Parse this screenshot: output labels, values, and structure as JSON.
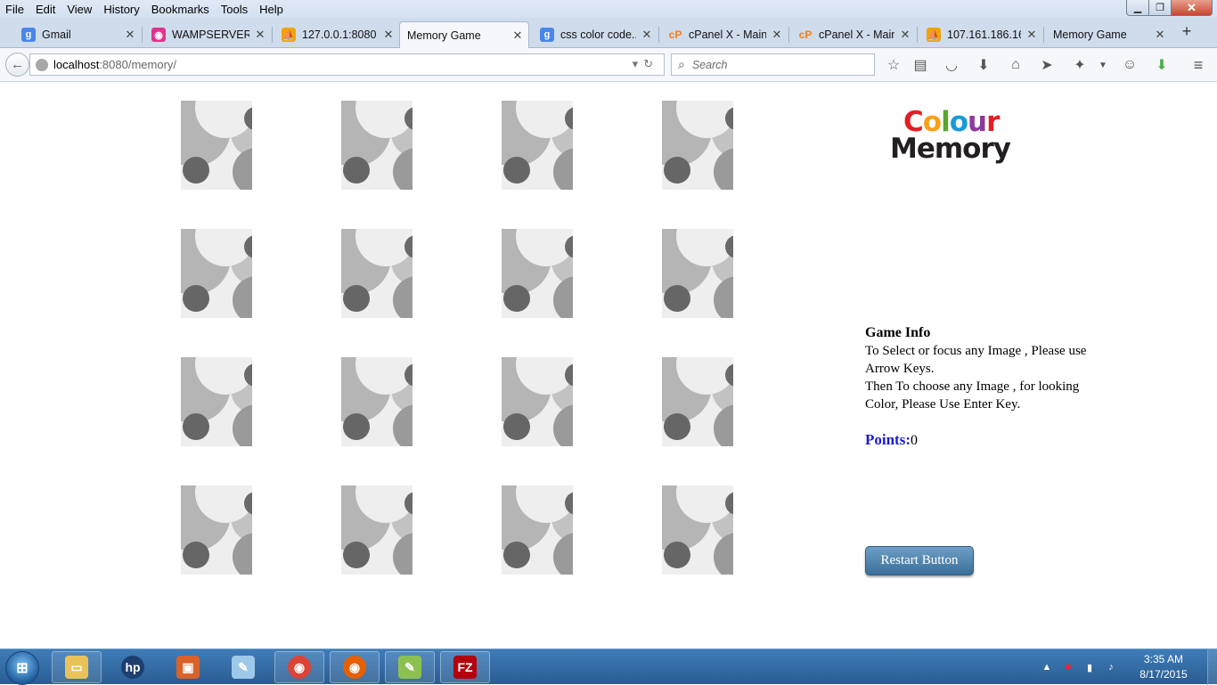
{
  "browser": {
    "menu": [
      "File",
      "Edit",
      "View",
      "History",
      "Bookmarks",
      "Tools",
      "Help"
    ],
    "tabs": [
      {
        "title": "Gmail",
        "icon": "google-icon",
        "icon_color": "#4a86e8",
        "active": false
      },
      {
        "title": "WAMPSERVER...",
        "icon": "wamp-icon",
        "icon_color": "#e0338d",
        "active": false
      },
      {
        "title": "127.0.0.1:8080 ...",
        "icon": "phpmyadmin-icon",
        "icon_color": "#f0a30a",
        "active": false
      },
      {
        "title": "Memory Game",
        "icon": "",
        "icon_color": "",
        "active": true
      },
      {
        "title": "css color code...",
        "icon": "google-icon",
        "icon_color": "#4a86e8",
        "active": false
      },
      {
        "title": "cPanel X - Main",
        "icon": "cpanel-icon",
        "icon_color": "#f57f17",
        "active": false
      },
      {
        "title": "cPanel X - Main",
        "icon": "cpanel-icon",
        "icon_color": "#f57f17",
        "active": false
      },
      {
        "title": "107.161.186.16...",
        "icon": "phpmyadmin-icon",
        "icon_color": "#f0a30a",
        "active": false
      },
      {
        "title": "Memory Game",
        "icon": "",
        "icon_color": "",
        "active": false
      }
    ],
    "url_host": "localhost",
    "url_path": ":8080/memory/",
    "search_placeholder": "Search"
  },
  "game": {
    "logo_word1": "Colour",
    "logo_word2": "Memory",
    "logo_colors": [
      "#e31e24",
      "#f7a11a",
      "#5aa631",
      "#1a9ad7",
      "#8b3a9a",
      "#e31e24"
    ],
    "grid_rows": 4,
    "grid_cols": 4,
    "card_state": "face-down",
    "info_title": "Game Info",
    "info_line1": "To Select or focus any Image , Please use Arrow Keys.",
    "info_line2": "Then To choose any Image , for looking Color, Please Use Enter Key.",
    "points_label": "Points:",
    "points_value": "0",
    "restart_label": "Restart Button"
  },
  "taskbar": {
    "apps": [
      "windows-explorer-icon",
      "hp-icon",
      "installer-icon",
      "notepad-icon",
      "chrome-icon",
      "firefox-icon",
      "notepad-plus-plus-icon",
      "filezilla-icon"
    ],
    "time": "3:35 AM",
    "date": "8/17/2015"
  }
}
